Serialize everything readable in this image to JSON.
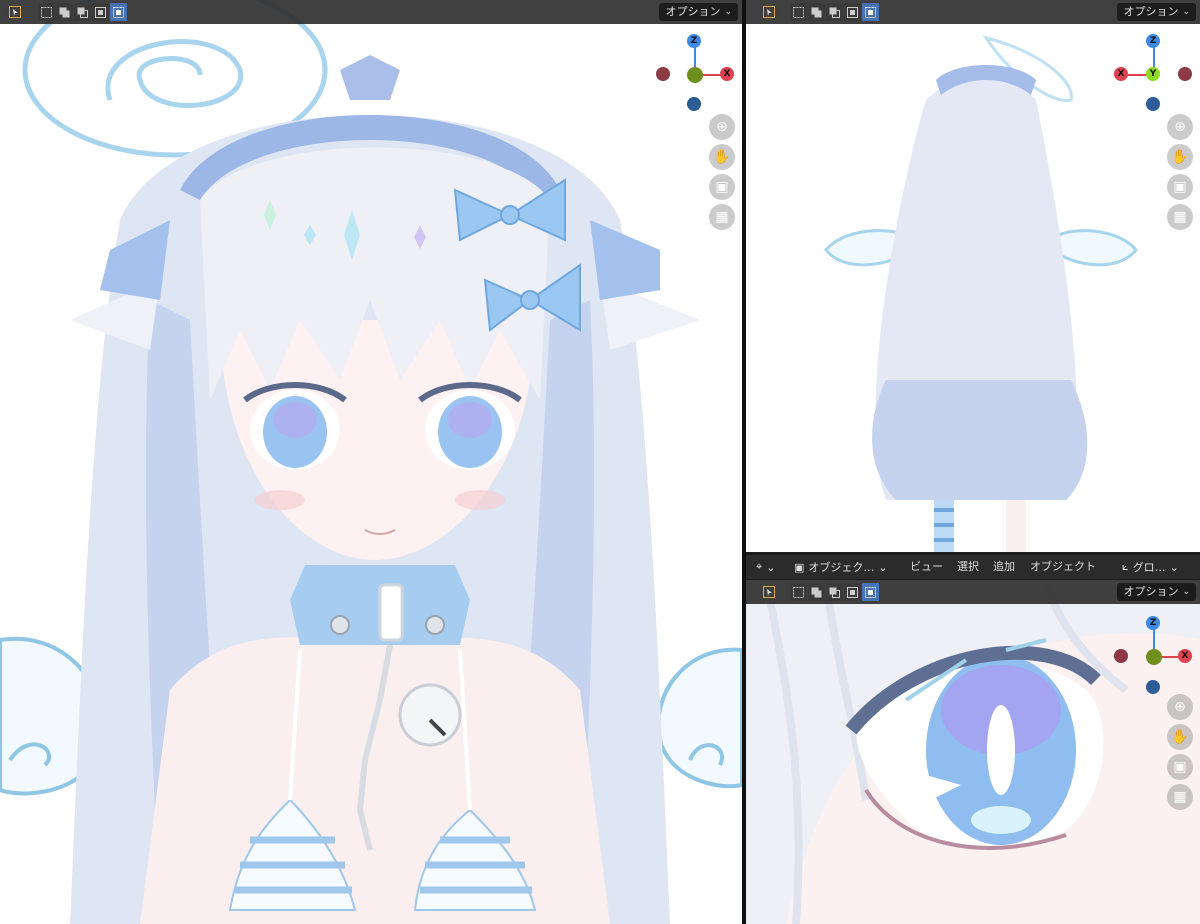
{
  "viewports": {
    "main": {
      "options_label": "オプション"
    },
    "back": {
      "options_label": "オプション"
    },
    "eye": {
      "options_label": "オプション"
    }
  },
  "gizmo": {
    "main": {
      "z": "Z",
      "x": "X"
    },
    "back": {
      "z": "Z",
      "x": "X",
      "y": "Y"
    },
    "eye": {
      "z": "Z",
      "x": "X"
    }
  },
  "editor_header": {
    "mode_label": "オブジェク…",
    "menu_view": "ビュー",
    "menu_select": "選択",
    "menu_add": "追加",
    "menu_object": "オブジェクト",
    "orientation_label": "グロ…"
  },
  "colors": {
    "x_axis": "#e0424f",
    "y_axis": "#8bdc1f",
    "z_axis": "#3d8ae5",
    "selection_active": "#4772b3"
  },
  "icons": [
    "select-tool-icon",
    "zoom-icon",
    "hand-pan-icon",
    "camera-icon",
    "grid-perspective-icon"
  ]
}
